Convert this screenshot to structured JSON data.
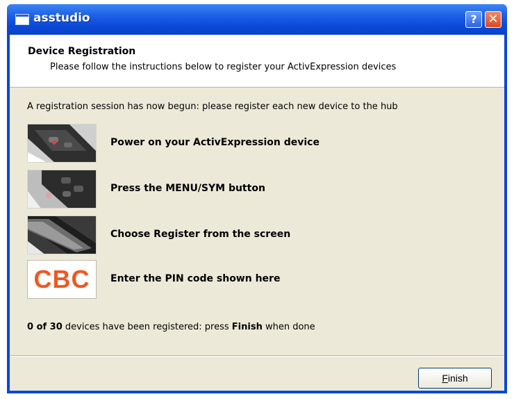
{
  "window": {
    "title": "asstudio",
    "help_glyph": "?",
    "close_glyph": "✕"
  },
  "header": {
    "title": "Device Registration",
    "subtitle": "Please follow the instructions below to register your ActivExpression devices"
  },
  "intro": "A registration session has now begun: please register each new device to the hub",
  "steps": [
    {
      "label": "Power on your ActivExpression device",
      "icon": "device-power-photo"
    },
    {
      "label": "Press the MENU/SYM button",
      "icon": "device-menu-photo"
    },
    {
      "label": "Choose Register from the screen",
      "icon": "device-screen-photo"
    },
    {
      "label": "Enter the PIN code shown here",
      "pin": "CBC"
    }
  ],
  "status": {
    "count": "0 of 30",
    "middle": " devices have been registered: press ",
    "finish_word": "Finish",
    "end": " when done"
  },
  "footer": {
    "finish_first": "F",
    "finish_rest": "inish"
  },
  "colors": {
    "pin": "#ec5a22",
    "title_bar": "#0b4ad8"
  }
}
